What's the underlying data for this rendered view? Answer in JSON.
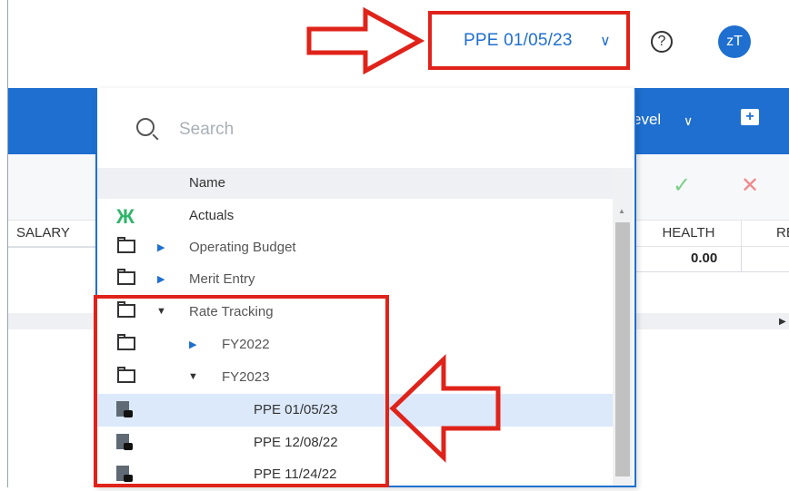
{
  "header": {
    "period_selector": "PPE 01/05/23",
    "help_glyph": "?",
    "avatar_initials": "zT"
  },
  "toolbar": {
    "level_label": "evel",
    "add_comment_glyph": "+"
  },
  "grid": {
    "columns": [
      "SALARY",
      "HEALTH",
      "RE"
    ],
    "health_value": "0.00"
  },
  "dropdown": {
    "search_placeholder": "Search",
    "name_header": "Name",
    "items": [
      {
        "label": "Actuals",
        "icon": "actuals-icon"
      },
      {
        "label": "Operating Budget",
        "icon": "folder-icon",
        "expand": "collapsed"
      },
      {
        "label": "Merit Entry",
        "icon": "folder-icon",
        "expand": "collapsed"
      },
      {
        "label": "Rate Tracking",
        "icon": "folder-icon",
        "expand": "expanded"
      },
      {
        "label": "FY2022",
        "icon": "folder-icon",
        "expand": "collapsed"
      },
      {
        "label": "FY2023",
        "icon": "folder-icon",
        "expand": "expanded"
      },
      {
        "label": "PPE 01/05/23",
        "icon": "locked-calculator-icon",
        "selected": true
      },
      {
        "label": "PPE 12/08/22",
        "icon": "locked-calculator-icon"
      },
      {
        "label": "PPE 11/24/22",
        "icon": "locked-calculator-icon"
      }
    ]
  },
  "colors": {
    "accent": "#1f6fd0",
    "callout": "#e0231a",
    "selected_row": "#dbe9fa",
    "actuals": "#2fb56b"
  }
}
